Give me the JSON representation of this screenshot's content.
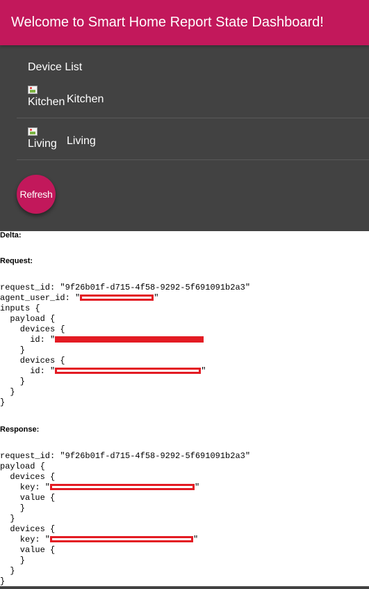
{
  "header": {
    "title": "Welcome to Smart Home Report State Dashboard!"
  },
  "colors": {
    "primary": "#c2185b",
    "panel": "#424242",
    "redaction": "#e31b23"
  },
  "device_list": {
    "title": "Device List",
    "devices": [
      {
        "image_alt": "Kitchen",
        "name": "Kitchen",
        "icon": "broken-image-icon"
      },
      {
        "image_alt": "Living",
        "name": "Living",
        "icon": "broken-image-icon"
      }
    ],
    "refresh_label": "Refresh"
  },
  "report": {
    "delta_label": "Delta:",
    "request_label": "Request:",
    "response_label": "Response:",
    "request_id_line": "request_id: \"9f26b01f-d715-4f58-9292-5f691091b2a3\"",
    "agent_user_id_prefix": "agent_user_id: \"",
    "quote_close": "\"",
    "inputs_open": "inputs {",
    "payload_open": "  payload {",
    "devices_open": "    devices {",
    "id_prefix": "      id: \"",
    "close_4": "    }",
    "close_2": "  }",
    "close_0": "}",
    "response_request_id_line": "request_id: \"9f26b01f-d715-4f58-9292-5f691091b2a3\"",
    "payload_open_top": "payload {",
    "devices_open_2": "  devices {",
    "key_prefix": "    key: \"",
    "value_open": "    value {",
    "value_close": "    }"
  }
}
